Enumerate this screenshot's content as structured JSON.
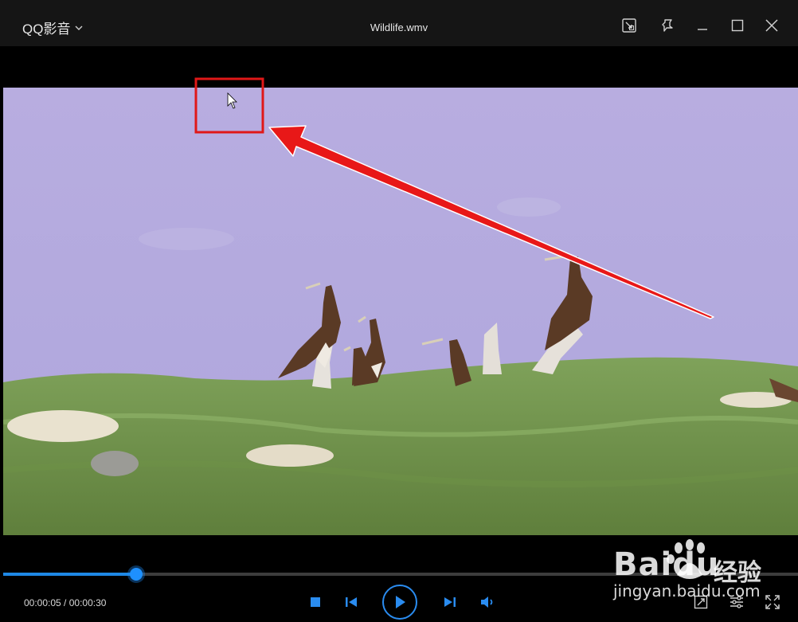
{
  "app": {
    "name": "QQ影音",
    "file_title": "Wildlife.wmv"
  },
  "player": {
    "current_time": "00:00:05",
    "separator": " / ",
    "total_time": "00:00:30",
    "progress": 0.167
  },
  "watermark": {
    "brand": "Baidu",
    "cn": "经验",
    "url": "jingyan.baidu.com"
  },
  "colors": {
    "accent": "#1e88e5",
    "annotation": "#e01818"
  }
}
